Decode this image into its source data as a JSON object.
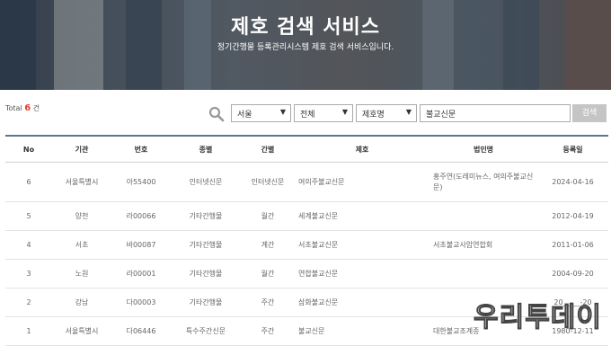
{
  "hero": {
    "title": "제호 검색 서비스",
    "subtitle": "정기간행물 등록관리시스템 제호 검색 서비스입니다."
  },
  "total": {
    "prefix": "Total",
    "count": "6",
    "suffix": "건"
  },
  "search": {
    "region": "서울",
    "category": "전체",
    "field": "제호명",
    "keyword": "불교신문",
    "button": "검색",
    "icon": "search-icon"
  },
  "table": {
    "headers": [
      "No",
      "기관",
      "번호",
      "종별",
      "간별",
      "제호",
      "법인명",
      "등록일"
    ],
    "rows": [
      [
        "6",
        "서울특별시",
        "아55400",
        "인터넷신문",
        "인터넷신문",
        "여의주불교신문",
        "홍주연(도레미뉴스, 여의주불교신문)",
        "2024-04-16"
      ],
      [
        "5",
        "양천",
        "라00066",
        "기타간행물",
        "월간",
        "세계불교신문",
        "",
        "2012-04-19"
      ],
      [
        "4",
        "서초",
        "바00087",
        "기타간행물",
        "계간",
        "서초불교신문",
        "서초불교사암연합회",
        "2011-01-06"
      ],
      [
        "3",
        "노원",
        "라00001",
        "기타간행물",
        "월간",
        "연합불교신문",
        "",
        "2004-09-20"
      ],
      [
        "2",
        "강남",
        "다00003",
        "기타간행물",
        "주간",
        "삼화불교신문",
        "",
        "20__-__-20"
      ],
      [
        "1",
        "서울특별시",
        "다06446",
        "특수주간신문",
        "주간",
        "불교신문",
        "대한불교조계종",
        "1980-12-11"
      ]
    ]
  },
  "watermark": "우리투데이",
  "colors": {
    "accent": "#e03c31",
    "header_rule": "#5b7793",
    "button": "#c5c5c5"
  }
}
